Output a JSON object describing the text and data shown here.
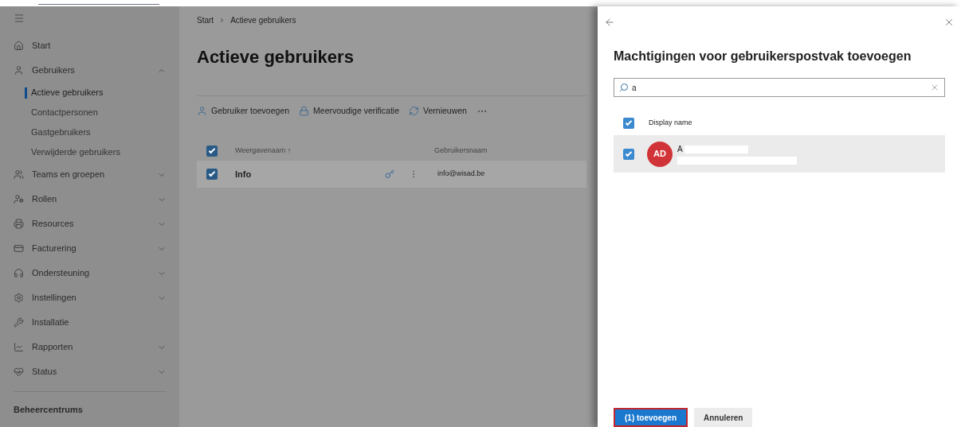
{
  "sidebar": {
    "items": [
      {
        "label": "Start"
      },
      {
        "label": "Gebruikers",
        "expanded": true,
        "children": [
          {
            "label": "Actieve gebruikers",
            "selected": true
          },
          {
            "label": "Contactpersonen",
            "selected": false
          },
          {
            "label": "Gastgebruikers",
            "selected": false
          },
          {
            "label": "Verwijderde gebruikers",
            "selected": false
          }
        ]
      },
      {
        "label": "Teams en groepen",
        "expanded": false
      },
      {
        "label": "Rollen",
        "expanded": false
      },
      {
        "label": "Resources",
        "expanded": false
      },
      {
        "label": "Facturering",
        "expanded": false
      },
      {
        "label": "Ondersteuning",
        "expanded": false
      },
      {
        "label": "Instellingen",
        "expanded": false
      },
      {
        "label": "Installatie"
      },
      {
        "label": "Rapporten",
        "expanded": false
      },
      {
        "label": "Status",
        "expanded": false
      }
    ],
    "section_title": "Beheercentrums"
  },
  "main": {
    "breadcrumb": [
      "Start",
      "Actieve gebruikers"
    ],
    "title": "Actieve gebruikers",
    "toolbar": [
      {
        "label": "Gebruiker toevoegen"
      },
      {
        "label": "Meervoudige verificatie"
      },
      {
        "label": "Vernieuwen"
      }
    ],
    "table": {
      "columns": [
        "Weergavenaam ↑",
        "Gebruikersnaam"
      ],
      "all_checked": true,
      "rows": [
        {
          "name": "Info",
          "username": "info@wisad.be",
          "checked": true
        }
      ]
    }
  },
  "panel": {
    "title": "Machtigingen voor gebruikerspostvak toevoegen",
    "search": {
      "value": "a"
    },
    "column": "Display name",
    "all_checked": true,
    "rows": [
      {
        "initials": "AD",
        "name": "A",
        "checked": true,
        "color": "#d13438"
      }
    ],
    "buttons": [
      {
        "label": "(1) toevoegen",
        "kind": "primary"
      },
      {
        "label": "Annuleren",
        "kind": "secondary"
      }
    ]
  }
}
